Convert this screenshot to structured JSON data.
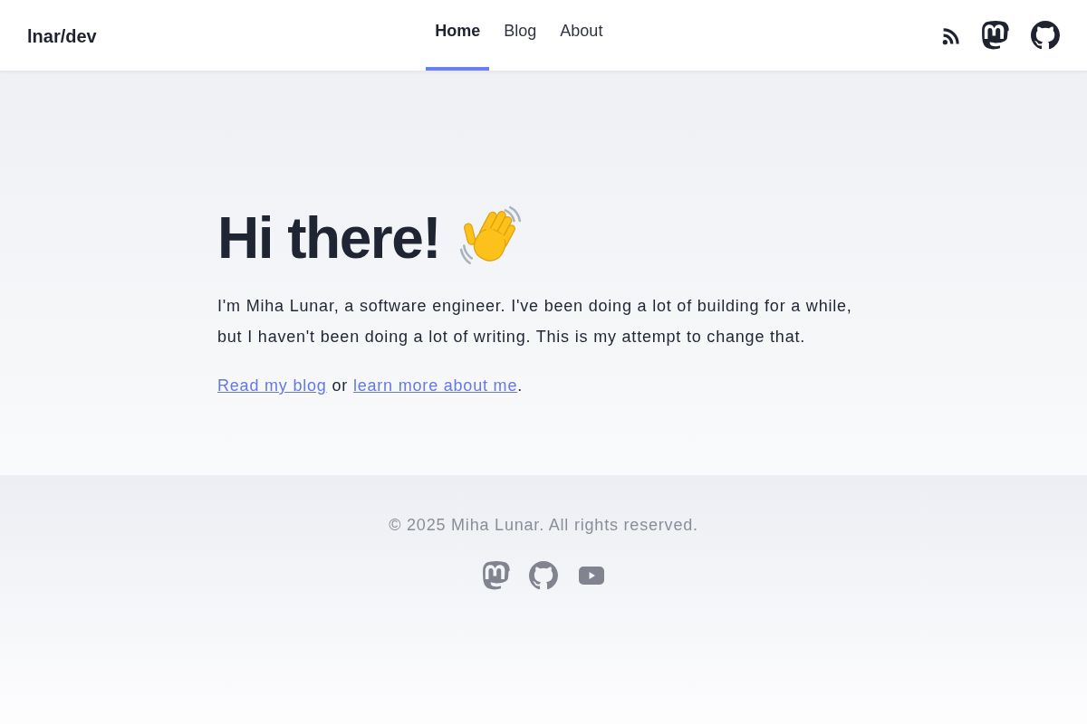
{
  "header": {
    "logo": "lnar/dev",
    "nav": [
      {
        "label": "Home",
        "selected": true
      },
      {
        "label": "Blog",
        "selected": false
      },
      {
        "label": "About",
        "selected": false
      }
    ]
  },
  "hero": {
    "heading": "Hi there!",
    "intro": "I'm Miha Lunar, a software engineer. I've been doing a lot of building for a while, but I haven't been doing a lot of writing. This is my attempt to change that.",
    "cta": [
      {
        "kind": "link",
        "text": "Read my blog"
      },
      {
        "kind": "text",
        "text": "or"
      },
      {
        "kind": "link",
        "text": "learn more about me"
      },
      {
        "kind": "punctuation",
        "text": "."
      }
    ]
  },
  "footer": {
    "copyright": "© 2025 Miha Lunar. All rights reserved."
  }
}
